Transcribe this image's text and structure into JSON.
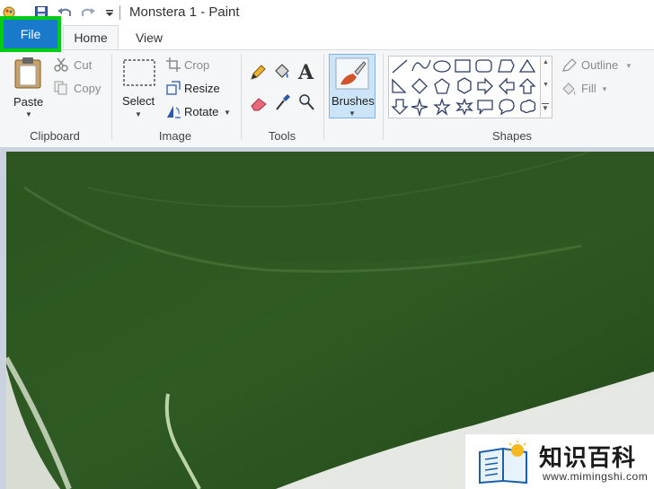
{
  "window": {
    "title": "Monstera 1 - Paint"
  },
  "tabs": {
    "file": "File",
    "home": "Home",
    "view": "View"
  },
  "clipboard": {
    "group": "Clipboard",
    "paste": "Paste",
    "cut": "Cut",
    "copy": "Copy"
  },
  "image": {
    "group": "Image",
    "select": "Select",
    "crop": "Crop",
    "resize": "Resize",
    "rotate": "Rotate"
  },
  "tools": {
    "group": "Tools",
    "text_glyph": "A"
  },
  "brushes": {
    "label": "Brushes"
  },
  "shapes": {
    "group": "Shapes",
    "outline": "Outline",
    "fill": "Fill"
  },
  "watermark": {
    "text": "知识百科",
    "url": "www.mimingshi.com"
  },
  "colors": {
    "file_tab": "#1979ca",
    "highlight": "#00cc11",
    "leaf": "#2f5a23",
    "brush_active": "#cce4f7"
  }
}
